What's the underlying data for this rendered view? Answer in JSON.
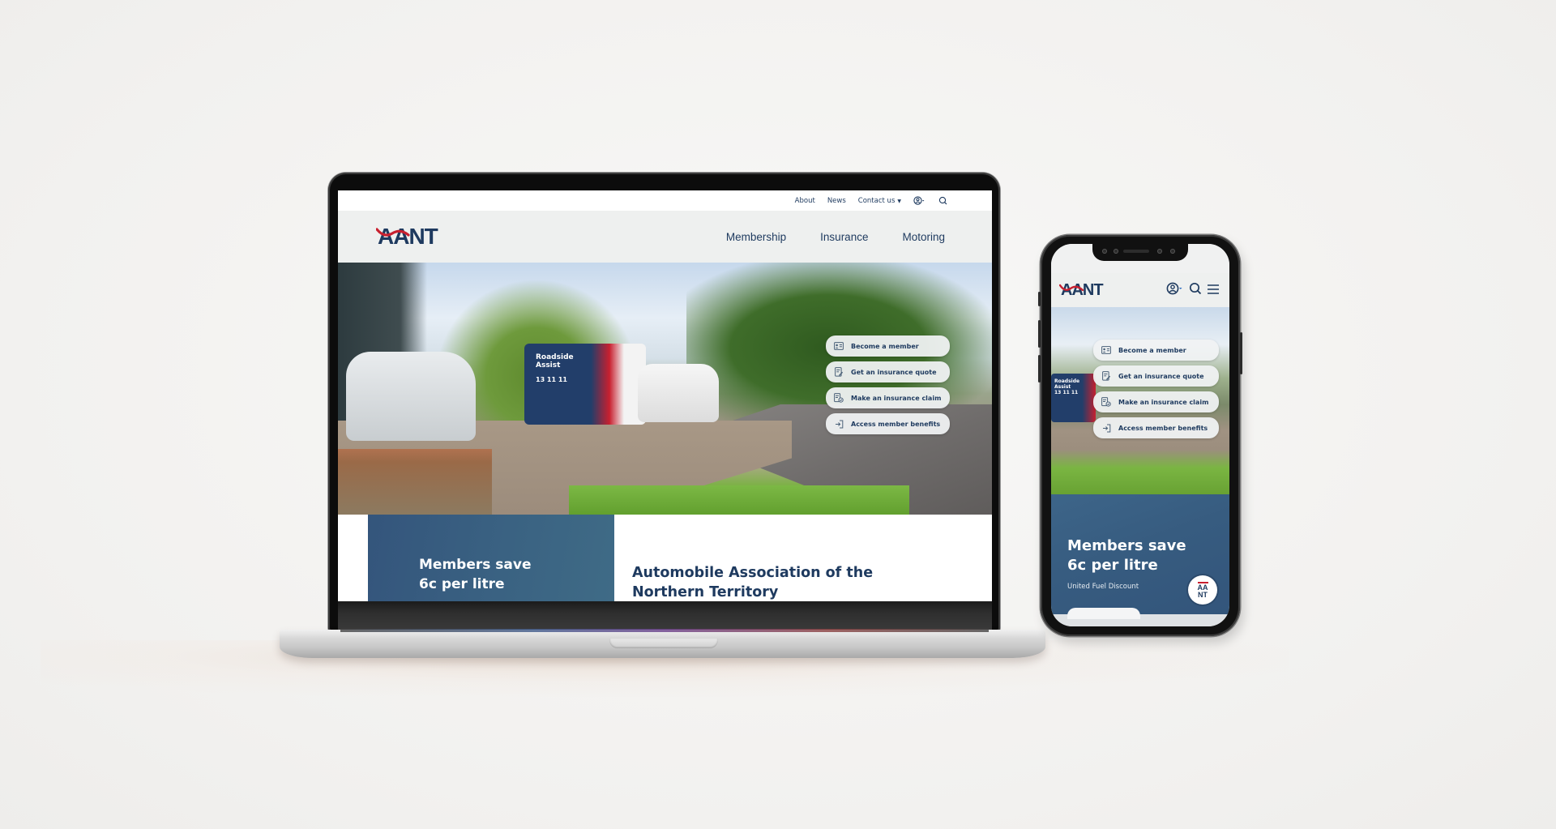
{
  "brand": {
    "logo_text": "AANT",
    "badge_top": "AA",
    "badge_bottom": "NT",
    "primary_color": "#1e3a5f",
    "accent_color": "#c8202f",
    "promo_color": "#34557c"
  },
  "laptop": {
    "top_links": [
      {
        "label": "About"
      },
      {
        "label": "News"
      },
      {
        "label": "Contact us",
        "has_dropdown": true
      }
    ],
    "top_icons": [
      "account-icon",
      "search-icon"
    ],
    "nav": [
      {
        "label": "Membership"
      },
      {
        "label": "Insurance"
      },
      {
        "label": "Motoring"
      }
    ],
    "hero": {
      "van_label_line1": "Roadside",
      "van_label_line2": "Assist",
      "van_phone": "13 11 11"
    },
    "quick_links": [
      {
        "label": "Become a member",
        "icon": "id-card-icon"
      },
      {
        "label": "Get an insurance quote",
        "icon": "document-edit-icon"
      },
      {
        "label": "Make an insurance claim",
        "icon": "document-check-icon"
      },
      {
        "label": "Access member benefits",
        "icon": "login-arrow-icon"
      }
    ],
    "promo": {
      "title_line1": "Members save",
      "title_line2": "6c per litre"
    },
    "intro": {
      "heading_line1": "Automobile Association of the",
      "heading_line2": "Northern Territory"
    }
  },
  "phone": {
    "header_icons": [
      "account-icon",
      "search-icon",
      "menu-icon"
    ],
    "hero": {
      "van_label_line1": "Roadside",
      "van_label_line2": "Assist",
      "van_phone": "13 11 11"
    },
    "quick_links": [
      {
        "label": "Become a member",
        "icon": "id-card-icon"
      },
      {
        "label": "Get an insurance quote",
        "icon": "document-edit-icon"
      },
      {
        "label": "Make an insurance claim",
        "icon": "document-check-icon"
      },
      {
        "label": "Access member benefits",
        "icon": "login-arrow-icon"
      }
    ],
    "promo": {
      "title_line1": "Members save",
      "title_line2": "6c per litre",
      "subtitle": "United Fuel Discount"
    }
  }
}
